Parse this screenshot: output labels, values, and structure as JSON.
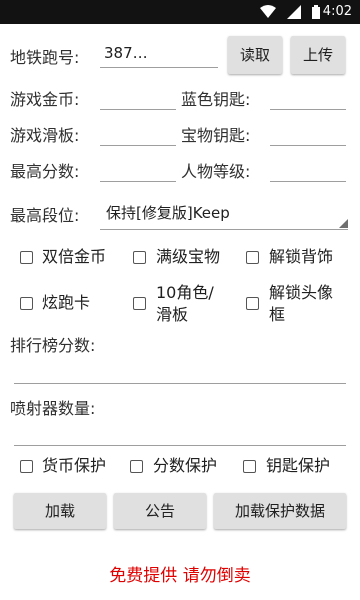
{
  "status_bar": {
    "time": "4:02",
    "icons": [
      "wifi-icon",
      "signal-icon",
      "battery-icon"
    ]
  },
  "form": {
    "subway_label": "地铁跑号:",
    "subway_value": "387…",
    "read_button": "读取",
    "upload_button": "上传",
    "game_coins_label": "游戏金币:",
    "blue_key_label": "蓝色钥匙:",
    "game_board_label": "游戏滑板:",
    "treasure_key_label": "宝物钥匙:",
    "high_score_label": "最高分数:",
    "char_level_label": "人物等级:",
    "rank_label": "最高段位:",
    "rank_selected": "保持[修复版]Keep"
  },
  "checkboxes": {
    "double_coins": "双倍金币",
    "max_treasure": "满级宝物",
    "unlock_back": "解锁背饰",
    "cool_card": "炫跑卡",
    "ten_roles": "10角色/\n滑板",
    "unlock_avatar": "解锁头像\n框"
  },
  "leaderboard_label": "排行榜分数:",
  "jet_label": "喷射器数量:",
  "protect": {
    "coin_protect": "货币保护",
    "score_protect": "分数保护",
    "key_protect": "钥匙保护"
  },
  "buttons": {
    "load": "加载",
    "notice": "公告",
    "load_protect": "加载保护数据"
  },
  "footer_note": "免费提供 请勿倒卖",
  "colors": {
    "accent_red": "#e00000",
    "status_bar": "#121212",
    "button_bg": "#e0e0e0"
  }
}
